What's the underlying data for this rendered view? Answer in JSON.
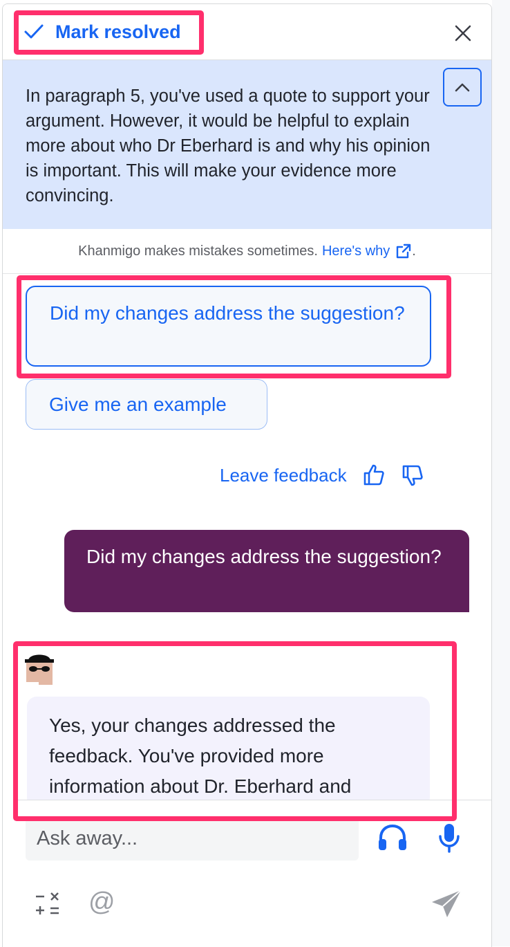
{
  "header": {
    "resolve_label": "Mark resolved"
  },
  "suggestion": {
    "text": "In paragraph 5, you've used a quote to support your argument. However, it would be helpful to explain more about who Dr Eberhard is and why his opinion is important. This will make your evidence more convincing."
  },
  "disclaimer": {
    "text": "Khanmigo makes mistakes sometimes.",
    "link": "Here's why",
    "period": "."
  },
  "chips": [
    {
      "label": "Did my changes address the suggestion?"
    },
    {
      "label": "Give me an example"
    }
  ],
  "feedback": {
    "label": "Leave feedback"
  },
  "messages": {
    "user": "Did my changes address the suggestion?",
    "bot": "Yes, your changes addressed the feedback. You've provided more information about Dr. Eberhard and"
  },
  "input": {
    "placeholder": "Ask away..."
  },
  "colors": {
    "accent": "#1865f2",
    "suggestion_bg": "#dae6fd",
    "user_bubble": "#5f1f5a",
    "bot_bubble": "#f3f2fd",
    "highlight": "#ff2f6c"
  },
  "icons": [
    "check-icon",
    "close-icon",
    "chevron-up-icon",
    "external-link-icon",
    "thumbs-up-icon",
    "thumbs-down-icon",
    "headphones-icon",
    "microphone-icon",
    "math-symbols-icon",
    "at-icon",
    "send-icon"
  ]
}
